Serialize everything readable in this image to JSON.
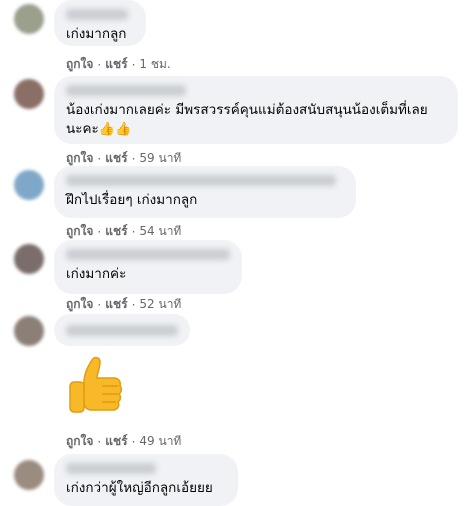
{
  "comments": [
    {
      "text": "เก่งมากลูก",
      "like": "ถูกใจ",
      "share": "แชร์",
      "sep": "·",
      "time": "1 ชม."
    },
    {
      "text": "น้องเก่งมากเลยค่ะ มีพรสวรรค์คุนแม่ต้องสนับสนุนน้องเต็มที่เลย",
      "text2": "นะคะ",
      "emoji": "👍👍",
      "like": "ถูกใจ",
      "share": "แชร์",
      "sep": "·",
      "time": "59 นาที"
    },
    {
      "text": "ฝึกไปเรื่อยๆ เก่งมากลูก",
      "like": "ถูกใจ",
      "share": "แชร์",
      "sep": "·",
      "time": "54 นาที"
    },
    {
      "text": "เก่งมากค่ะ",
      "like": "ถูกใจ",
      "share": "แชร์",
      "sep": "·",
      "time": "52 นาที"
    },
    {
      "like": "ถูกใจ",
      "share": "แชร์",
      "sep": "·",
      "time": "49 นาที"
    },
    {
      "text": "เก่งกว่าผู้ใหญ่อีกลูกเอ้ยยย"
    }
  ],
  "colors": {
    "bubble": "#f0f2f5",
    "meta": "#65676b",
    "text": "#050505",
    "thumb": "#f7b928"
  }
}
